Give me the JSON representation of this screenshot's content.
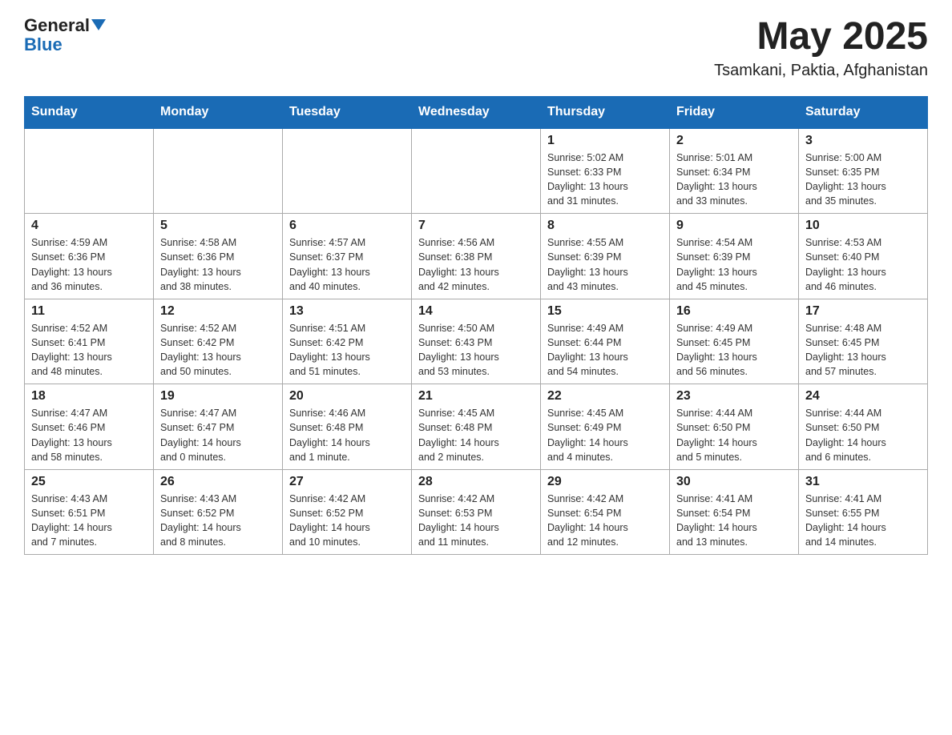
{
  "header": {
    "logo_general": "General",
    "logo_blue": "Blue",
    "month_year": "May 2025",
    "location": "Tsamkani, Paktia, Afghanistan"
  },
  "weekdays": [
    "Sunday",
    "Monday",
    "Tuesday",
    "Wednesday",
    "Thursday",
    "Friday",
    "Saturday"
  ],
  "weeks": [
    [
      {
        "day": "",
        "info": ""
      },
      {
        "day": "",
        "info": ""
      },
      {
        "day": "",
        "info": ""
      },
      {
        "day": "",
        "info": ""
      },
      {
        "day": "1",
        "info": "Sunrise: 5:02 AM\nSunset: 6:33 PM\nDaylight: 13 hours\nand 31 minutes."
      },
      {
        "day": "2",
        "info": "Sunrise: 5:01 AM\nSunset: 6:34 PM\nDaylight: 13 hours\nand 33 minutes."
      },
      {
        "day": "3",
        "info": "Sunrise: 5:00 AM\nSunset: 6:35 PM\nDaylight: 13 hours\nand 35 minutes."
      }
    ],
    [
      {
        "day": "4",
        "info": "Sunrise: 4:59 AM\nSunset: 6:36 PM\nDaylight: 13 hours\nand 36 minutes."
      },
      {
        "day": "5",
        "info": "Sunrise: 4:58 AM\nSunset: 6:36 PM\nDaylight: 13 hours\nand 38 minutes."
      },
      {
        "day": "6",
        "info": "Sunrise: 4:57 AM\nSunset: 6:37 PM\nDaylight: 13 hours\nand 40 minutes."
      },
      {
        "day": "7",
        "info": "Sunrise: 4:56 AM\nSunset: 6:38 PM\nDaylight: 13 hours\nand 42 minutes."
      },
      {
        "day": "8",
        "info": "Sunrise: 4:55 AM\nSunset: 6:39 PM\nDaylight: 13 hours\nand 43 minutes."
      },
      {
        "day": "9",
        "info": "Sunrise: 4:54 AM\nSunset: 6:39 PM\nDaylight: 13 hours\nand 45 minutes."
      },
      {
        "day": "10",
        "info": "Sunrise: 4:53 AM\nSunset: 6:40 PM\nDaylight: 13 hours\nand 46 minutes."
      }
    ],
    [
      {
        "day": "11",
        "info": "Sunrise: 4:52 AM\nSunset: 6:41 PM\nDaylight: 13 hours\nand 48 minutes."
      },
      {
        "day": "12",
        "info": "Sunrise: 4:52 AM\nSunset: 6:42 PM\nDaylight: 13 hours\nand 50 minutes."
      },
      {
        "day": "13",
        "info": "Sunrise: 4:51 AM\nSunset: 6:42 PM\nDaylight: 13 hours\nand 51 minutes."
      },
      {
        "day": "14",
        "info": "Sunrise: 4:50 AM\nSunset: 6:43 PM\nDaylight: 13 hours\nand 53 minutes."
      },
      {
        "day": "15",
        "info": "Sunrise: 4:49 AM\nSunset: 6:44 PM\nDaylight: 13 hours\nand 54 minutes."
      },
      {
        "day": "16",
        "info": "Sunrise: 4:49 AM\nSunset: 6:45 PM\nDaylight: 13 hours\nand 56 minutes."
      },
      {
        "day": "17",
        "info": "Sunrise: 4:48 AM\nSunset: 6:45 PM\nDaylight: 13 hours\nand 57 minutes."
      }
    ],
    [
      {
        "day": "18",
        "info": "Sunrise: 4:47 AM\nSunset: 6:46 PM\nDaylight: 13 hours\nand 58 minutes."
      },
      {
        "day": "19",
        "info": "Sunrise: 4:47 AM\nSunset: 6:47 PM\nDaylight: 14 hours\nand 0 minutes."
      },
      {
        "day": "20",
        "info": "Sunrise: 4:46 AM\nSunset: 6:48 PM\nDaylight: 14 hours\nand 1 minute."
      },
      {
        "day": "21",
        "info": "Sunrise: 4:45 AM\nSunset: 6:48 PM\nDaylight: 14 hours\nand 2 minutes."
      },
      {
        "day": "22",
        "info": "Sunrise: 4:45 AM\nSunset: 6:49 PM\nDaylight: 14 hours\nand 4 minutes."
      },
      {
        "day": "23",
        "info": "Sunrise: 4:44 AM\nSunset: 6:50 PM\nDaylight: 14 hours\nand 5 minutes."
      },
      {
        "day": "24",
        "info": "Sunrise: 4:44 AM\nSunset: 6:50 PM\nDaylight: 14 hours\nand 6 minutes."
      }
    ],
    [
      {
        "day": "25",
        "info": "Sunrise: 4:43 AM\nSunset: 6:51 PM\nDaylight: 14 hours\nand 7 minutes."
      },
      {
        "day": "26",
        "info": "Sunrise: 4:43 AM\nSunset: 6:52 PM\nDaylight: 14 hours\nand 8 minutes."
      },
      {
        "day": "27",
        "info": "Sunrise: 4:42 AM\nSunset: 6:52 PM\nDaylight: 14 hours\nand 10 minutes."
      },
      {
        "day": "28",
        "info": "Sunrise: 4:42 AM\nSunset: 6:53 PM\nDaylight: 14 hours\nand 11 minutes."
      },
      {
        "day": "29",
        "info": "Sunrise: 4:42 AM\nSunset: 6:54 PM\nDaylight: 14 hours\nand 12 minutes."
      },
      {
        "day": "30",
        "info": "Sunrise: 4:41 AM\nSunset: 6:54 PM\nDaylight: 14 hours\nand 13 minutes."
      },
      {
        "day": "31",
        "info": "Sunrise: 4:41 AM\nSunset: 6:55 PM\nDaylight: 14 hours\nand 14 minutes."
      }
    ]
  ]
}
